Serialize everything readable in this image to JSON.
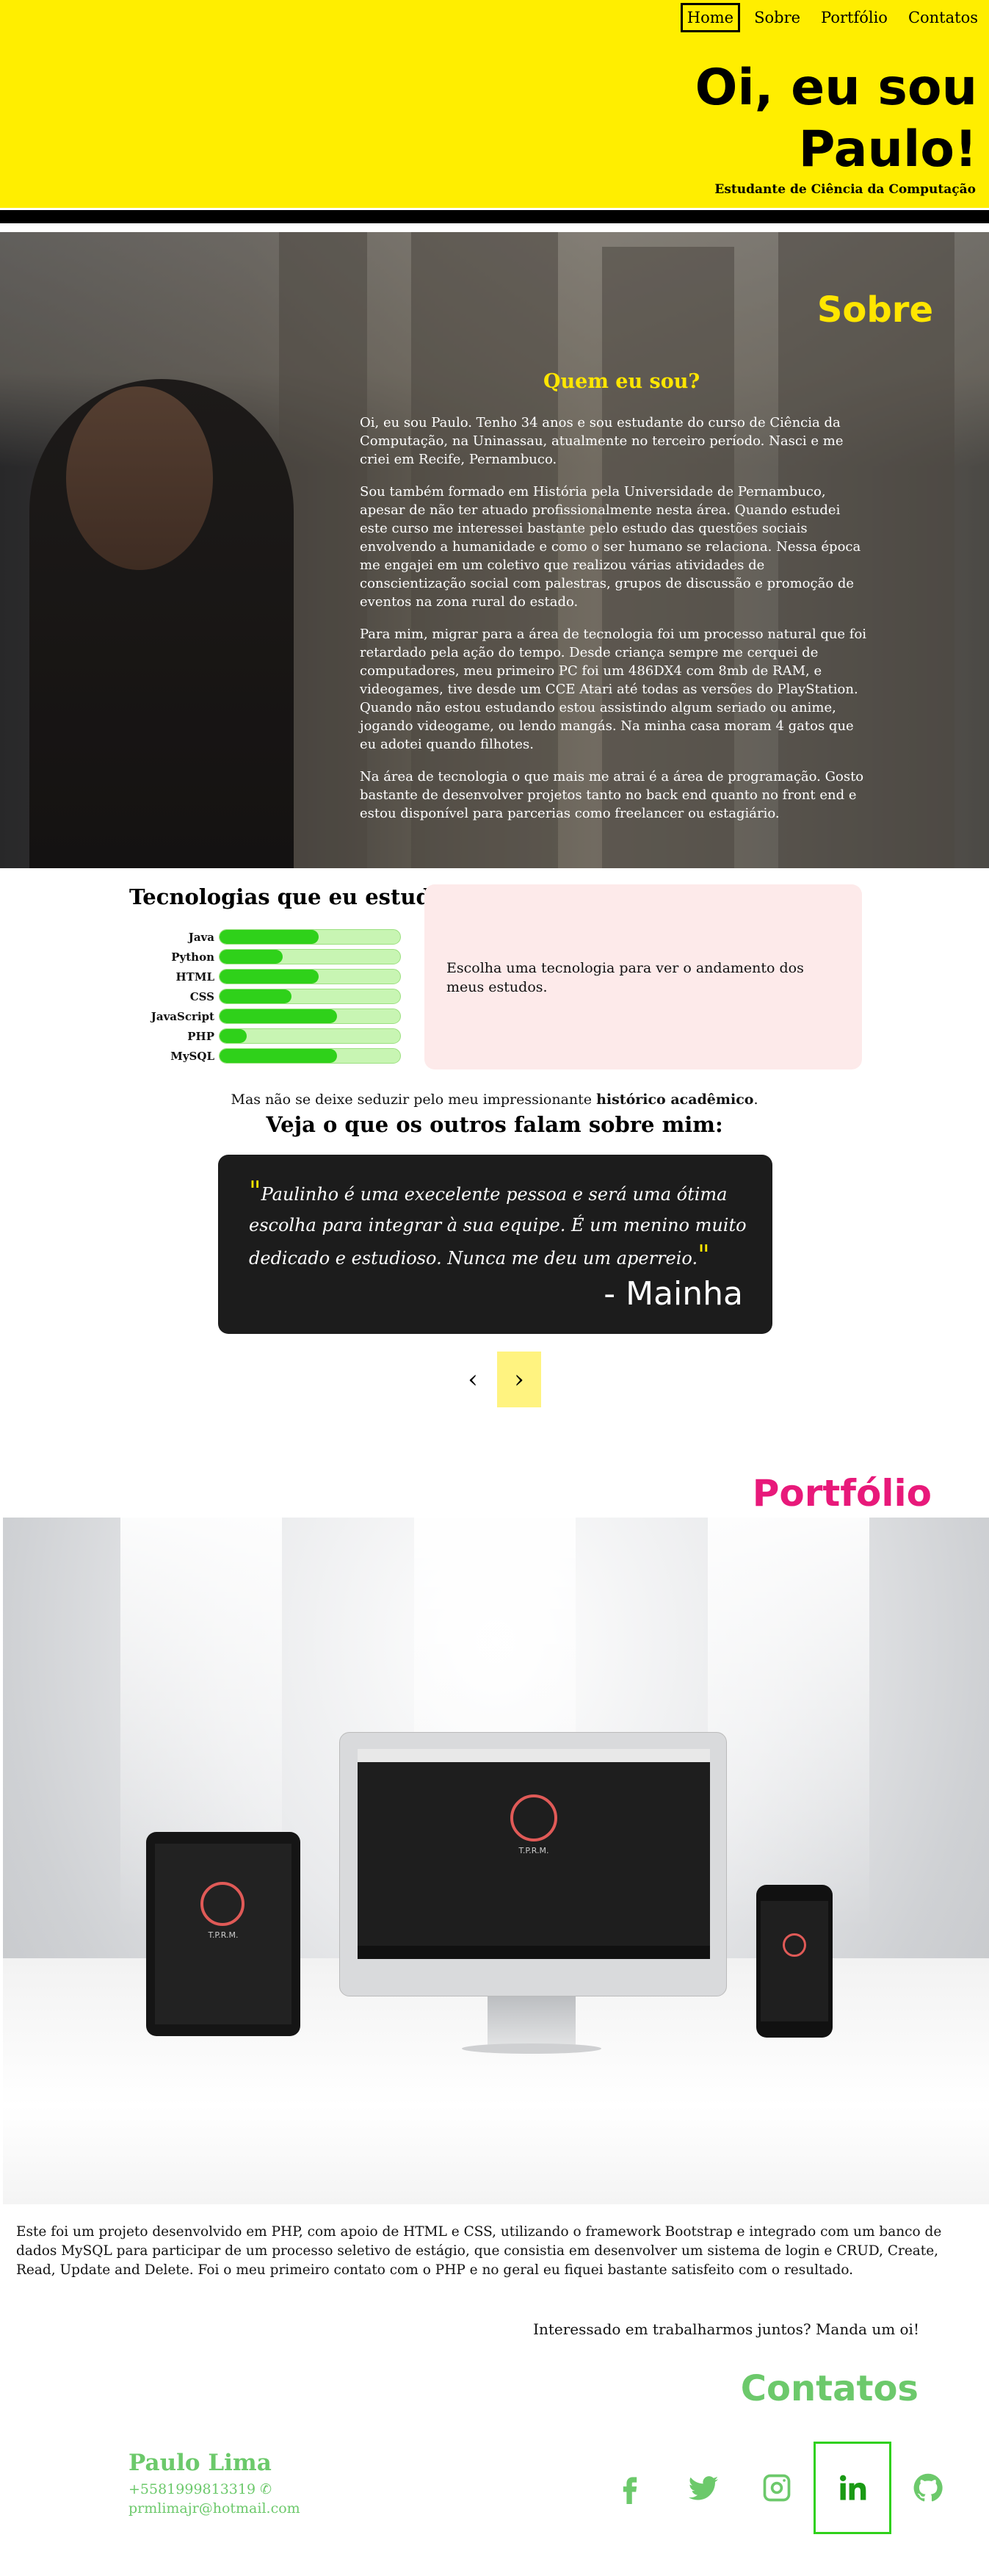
{
  "nav": {
    "items": [
      "Home",
      "Sobre",
      "Portfólio",
      "Contatos"
    ],
    "active": "Home"
  },
  "hero": {
    "title_line1": "Oi, eu sou",
    "title_line2": "Paulo!",
    "subtitle": "Estudante de Ciência da Computação"
  },
  "sobre": {
    "title": "Sobre",
    "question": "Quem eu sou?",
    "paragraphs": [
      "Oi, eu sou Paulo. Tenho 34 anos e sou estudante do curso de Ciência da Computação, na Uninassau, atualmente no terceiro período. Nasci e me criei em Recife, Pernambuco.",
      "Sou também formado em História pela Universidade de Pernambuco, apesar de não ter atuado profissionalmente nesta área. Quando estudei este curso me interessei bastante pelo estudo das questões sociais envolvendo a humanidade e como o ser humano se relaciona. Nessa época me engajei em um coletivo que realizou várias atividades de conscientização social com palestras, grupos de discussão e promoção de eventos na zona rural do estado.",
      "Para mim, migrar para a área de tecnologia foi um processo natural que foi retardado pela ação do tempo. Desde criança sempre me cerquei de computadores, meu primeiro PC foi um 486DX4 com 8mb de RAM, e videogames, tive desde um CCE Atari até todas as versões do PlayStation. Quando não estou estudando estou assistindo algum seriado ou anime, jogando videogame, ou lendo mangás. Na minha casa moram 4 gatos que eu adotei quando filhotes.",
      "Na área de tecnologia o que mais me atrai é a área de programação. Gosto bastante de desenvolver projetos tanto no back end quanto no front end e estou disponível para parcerias como freelancer ou estagiário."
    ]
  },
  "tech": {
    "title": "Tecnologias que eu estudo:",
    "items": [
      {
        "label": "Java",
        "progress": 0.55
      },
      {
        "label": "Python",
        "progress": 0.35
      },
      {
        "label": "HTML",
        "progress": 0.55
      },
      {
        "label": "CSS",
        "progress": 0.4
      },
      {
        "label": "JavaScript",
        "progress": 0.65
      },
      {
        "label": "PHP",
        "progress": 0.15
      },
      {
        "label": "MySQL",
        "progress": 0.65
      }
    ],
    "hint": "Escolha uma tecnologia para ver o andamento dos meus estudos."
  },
  "academic": {
    "prefix": "Mas não se deixe seduzir pelo meu impressionante ",
    "link": "histórico acadêmico",
    "suffix": "."
  },
  "testimonials": {
    "title": "Veja o que os outros falam sobre mim:",
    "quote": "Paulinho é uma execelente pessoa e será uma ótima escolha para integrar à sua equipe. É um menino muito dedicado e estudioso. Nunca me deu um aperreio.",
    "author": "- Mainha",
    "prev": "‹",
    "next": "›"
  },
  "portfolio": {
    "title": "Portfólio",
    "description": "Este foi um projeto desenvolvido em PHP, com apoio de HTML e CSS, utilizando o framework Bootstrap e integrado com um banco de dados MySQL para participar de um processo seletivo de estágio, que consistia em desenvolver um sistema de login e CRUD, Create, Read, Update and Delete. Foi o meu primeiro contato com o PHP e no geral eu fiquei bastante satisfeito com o resultado.",
    "brand": "T.P.R.M."
  },
  "contact": {
    "invite": "Interessado em trabalharmos juntos? Manda um oi!",
    "title": "Contatos",
    "name": "Paulo Lima",
    "phone": "+5581999813319",
    "email": "prmlimajr@hotmail.com",
    "socials": [
      "facebook-icon",
      "twitter-icon",
      "instagram-icon",
      "linkedin-icon",
      "github-icon"
    ]
  },
  "colors": {
    "yellow": "#ffee00",
    "green": "#6cc96b",
    "pink": "#e8197a",
    "bar_green": "#2fd11a"
  }
}
